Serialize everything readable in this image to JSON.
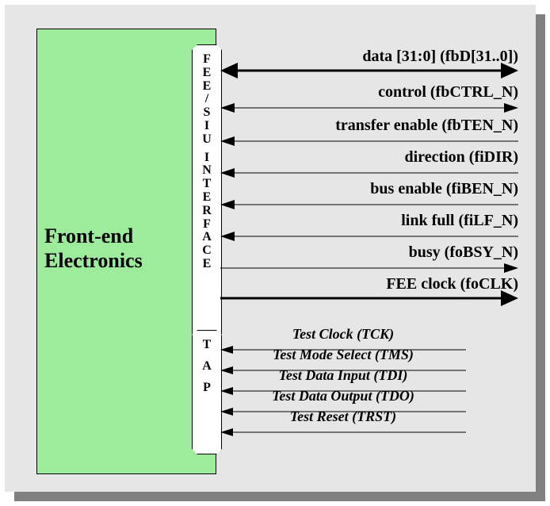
{
  "front_end_label_1": "Front-end",
  "front_end_label_2": "Electronics",
  "interface_chip_label": "FEE/SIU INTERFACE",
  "tap_chip_label": "TAP",
  "signals": {
    "s0": "data [31:0] (fbD[31..0])",
    "s1": "control (fbCTRL_N)",
    "s2": "transfer enable (fbTEN_N)",
    "s3": "direction (fiDIR)",
    "s4": "bus enable (fiBEN_N)",
    "s5": "link full (fiLF_N)",
    "s6": "busy (foBSY_N)",
    "s7": "FEE clock (foCLK)"
  },
  "tap_signals": {
    "t0": "Test Clock (TCK)",
    "t1": "Test Mode Select (TMS)",
    "t2": "Test Data Input (TDI)",
    "t3": "Test Data Output (TDO)",
    "t4": "Test Reset (TRST)"
  }
}
